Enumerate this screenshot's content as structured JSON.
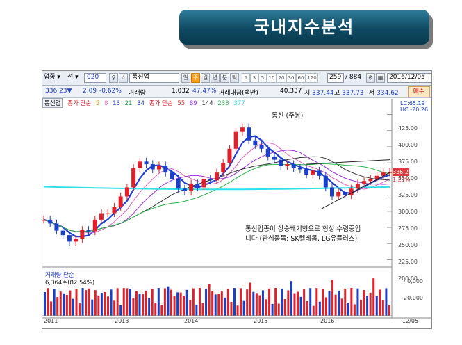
{
  "banner": {
    "title": "국내지수분석"
  },
  "toolbar": {
    "type_label": "업종",
    "market_label": "전",
    "code_value": "020",
    "name_value": "통신업",
    "period_buttons": [
      "일",
      "주",
      "월",
      "년",
      "분",
      "틱"
    ],
    "selected_period": "주",
    "minute_options": [
      "1",
      "3",
      "5",
      "10",
      "20",
      "30",
      "60",
      "120"
    ],
    "count_value": "259",
    "count_total": "/ 884",
    "date_value": "2016/12/05"
  },
  "infobar": {
    "price": "336.23",
    "direction": "▼",
    "change": "2.09",
    "change_pct": "-0.62%",
    "volume_label": "거래량",
    "volume_value": "1,032",
    "volume_ratio": "47.47%",
    "amount_label": "거래대금(백만)",
    "amount_value": "40,337",
    "open_label": "시",
    "open_value": "337.44",
    "high_label": "고",
    "high_value": "337.73",
    "low_label": "저",
    "low_value": "334.62",
    "sell_button": "매수"
  },
  "legend": {
    "name": "통신업",
    "close_label": "종가 단순",
    "close_periods": [
      "5",
      "8",
      "13",
      "21",
      "34"
    ],
    "close_label2": "종가 단순",
    "close_periods2": [
      "55",
      "89",
      "144",
      "233",
      "377"
    ]
  },
  "price_axis": {
    "lc": "LC:65.19",
    "hc": "HC:-20.26",
    "ticks": [
      "425.00",
      "400.00",
      "375.00",
      "350.00",
      "325.00",
      "300.00",
      "275.00",
      "250.00",
      "225.00",
      "200.00"
    ],
    "current": "336.23",
    "current_pct": "1.21%"
  },
  "chart_title": "통신 (주봉)",
  "annotation": {
    "line1": "통신업종이 상승쐐기형으로 형성 수렴중입",
    "line2": "니다 (관심종목: SK텔레콤, LG유플러스)"
  },
  "volume": {
    "label": "거래량 단순",
    "value": "6,364주(82.54%)",
    "ticks": [
      "40,000",
      "20,000"
    ]
  },
  "date_axis": [
    "2011",
    "2013",
    "2014",
    "2015",
    "2016",
    "12/05"
  ],
  "colors": {
    "up": "#e0202a",
    "down": "#1a3fc8",
    "ma_blue": "#1f3fd6",
    "ma_cyan": "#2fe0e8",
    "banner_top": "#2f7d9b",
    "banner_bottom": "#093a4f"
  },
  "chart_data": {
    "type": "line",
    "title": "통신 (주봉)",
    "ylim": [
      195,
      430
    ],
    "x": [
      "2011",
      "2013",
      "2014",
      "2015",
      "2016",
      "12/05"
    ],
    "series": [
      {
        "values": [
          262,
          256,
          245,
          238,
          228,
          232,
          246,
          244,
          262,
          272,
          272,
          282,
          298,
          312,
          342,
          352,
          348,
          340,
          346,
          335,
          325,
          310,
          306,
          318,
          312,
          325,
          323,
          335,
          350,
          372,
          398,
          405,
          385,
          378,
          372,
          360,
          355,
          345,
          348,
          342,
          340,
          332,
          338,
          330,
          312,
          298,
          305,
          300,
          310,
          318,
          322,
          325,
          330,
          335,
          336
        ]
      }
    ]
  }
}
